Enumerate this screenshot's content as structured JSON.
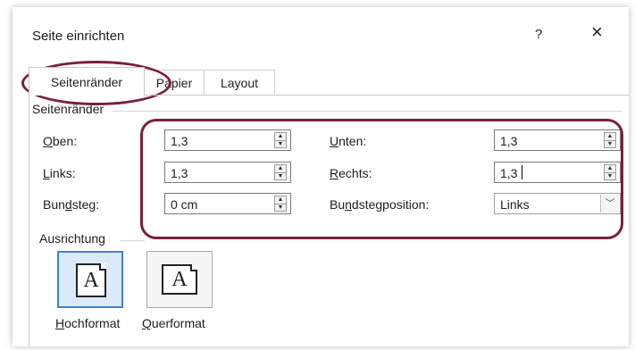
{
  "dialog": {
    "title": "Seite einrichten",
    "help_label": "?",
    "close_label": "×"
  },
  "tabs": [
    {
      "label": "Seitenränder",
      "active": true
    },
    {
      "label": "Papier",
      "active": false
    },
    {
      "label": "Layout",
      "active": false
    }
  ],
  "margins": {
    "group_label": "Seitenränder",
    "top": {
      "label_pre": "",
      "label_ul": "O",
      "label_post": "ben:",
      "value": "1,3"
    },
    "left": {
      "label_pre": "",
      "label_ul": "L",
      "label_post": "inks:",
      "value": "1,3"
    },
    "gutter": {
      "label_pre": "Bun",
      "label_ul": "d",
      "label_post": "steg:",
      "value": "0 cm"
    },
    "bottom": {
      "label_pre": "",
      "label_ul": "U",
      "label_post": "nten:",
      "value": "1,3"
    },
    "right": {
      "label_pre": "",
      "label_ul": "R",
      "label_post": "echts:",
      "value": "1,3"
    },
    "gutter_position": {
      "label_pre": "Bu",
      "label_ul": "n",
      "label_post": "dstegposition:",
      "value": "Links"
    }
  },
  "orientation": {
    "group_label": "Ausrichtung",
    "portrait": {
      "label_ul": "H",
      "label_post": "ochformat",
      "glyph": "A",
      "selected": true
    },
    "landscape": {
      "label_ul": "Q",
      "label_post": "uerformat",
      "glyph": "A",
      "selected": false
    }
  },
  "colors": {
    "highlight": "#7b1f3a",
    "selection": "#3b83d8"
  }
}
